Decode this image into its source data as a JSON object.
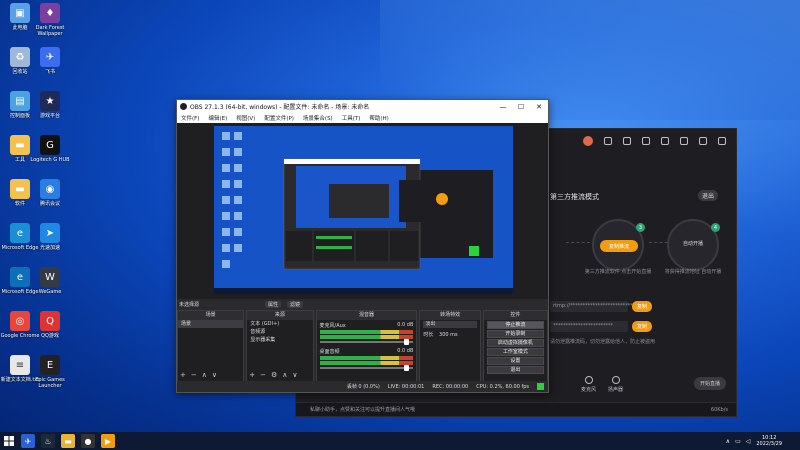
{
  "desktop": {
    "icons": [
      {
        "label": "此电脑",
        "icon": "computer-icon",
        "color": "#5aa0e6"
      },
      {
        "label": "Dark Forest Wallpaper",
        "icon": "game-icon",
        "color": "#7b3fa0"
      },
      {
        "label": "回收站",
        "icon": "recycle-bin-icon",
        "color": "#9fb8d8"
      },
      {
        "label": "飞书",
        "icon": "feishu-icon",
        "color": "#3c6df0"
      },
      {
        "label": "控制面板",
        "icon": "control-panel-icon",
        "color": "#4aa3df"
      },
      {
        "label": "游戏平台",
        "icon": "game-platform-icon",
        "color": "#1e2a5a"
      },
      {
        "label": "工具",
        "icon": "folder-icon",
        "color": "#f2c14e"
      },
      {
        "label": "Logitech G HUB",
        "icon": "logitech-icon",
        "color": "#111111"
      },
      {
        "label": "软件",
        "icon": "folder-icon",
        "color": "#f2c14e"
      },
      {
        "label": "腾讯会议",
        "icon": "meeting-icon",
        "color": "#2a7de1"
      },
      {
        "label": "Microsoft Edge",
        "icon": "edge-icon",
        "color": "#1a8fd4"
      },
      {
        "label": "光速加速",
        "icon": "accelerator-icon",
        "color": "#1e88e5"
      },
      {
        "label": "Microsoft Edge",
        "icon": "edge-icon",
        "color": "#0d6fb8"
      },
      {
        "label": "WeGame",
        "icon": "wegame-icon",
        "color": "#333a44"
      },
      {
        "label": "Google Chrome",
        "icon": "chrome-icon",
        "color": "#e8453c"
      },
      {
        "label": "QQ游戏",
        "icon": "qq-icon",
        "color": "#d33"
      },
      {
        "label": "新建文本文档.txt",
        "icon": "text-file-icon",
        "color": "#e8e8e8"
      },
      {
        "label": "Epic Games Launcher",
        "icon": "epic-icon",
        "color": "#222222"
      }
    ]
  },
  "bg_app": {
    "mode_text": "第三方推流模式",
    "exit_label": "退出",
    "step1_label": "复制推流",
    "step1_num": "3",
    "step1_text": "第三方推流软件 点击开始直播",
    "step2_label": "自动开播",
    "step2_num": "4",
    "step2_text": "将获得推流地址 自动开播",
    "field1": "rtmp://*************************",
    "field2": "************************",
    "copy_label": "复制",
    "hint": "请勿泄露推流码，切勿泄露给他人，防止被盗用",
    "controls": [
      "麦克风",
      "扬声器"
    ],
    "live_label": "开始直播",
    "footer": "私聊小助手，点赞和关注可以提升直播间人气哦",
    "speed": "60Kb/s"
  },
  "obs": {
    "title": "OBS 27.1.3 (64-bit, windows) - 配置文件: 未命名 - 场景: 未命名",
    "menu": [
      "文件(F)",
      "编辑(E)",
      "视图(V)",
      "配置文件(P)",
      "场景集合(S)",
      "工具(T)",
      "帮助(H)"
    ],
    "dock_left": "未选择源",
    "dock_props": "属性",
    "dock_filters": "滤镜",
    "scenes_title": "场景",
    "scenes": [
      "场景"
    ],
    "sources_title": "来源",
    "sources": [
      "文本 (GDI+)",
      "音频源",
      "显示器采集"
    ],
    "mixer_title": "混音器",
    "mixer": [
      {
        "name": "麦克风/Aux",
        "db": "0.0 dB"
      },
      {
        "name": "桌面音频",
        "db": "0.0 dB"
      }
    ],
    "transition_title": "转场特效",
    "transition_value": "淡出",
    "duration_label": "时长",
    "duration_value": "300 ms",
    "controls_title": "控件",
    "controls": [
      "停止推流",
      "开始录制",
      "启动虚拟摄像机",
      "工作室模式",
      "设置",
      "退出"
    ],
    "status": {
      "dropped": "丢帧 0 (0.0%)",
      "live": "LIVE: 00:00:01",
      "rec": "REC: 00:00:00",
      "cpu": "CPU: 0.2%, 60.00 fps"
    }
  },
  "taskbar": {
    "time": "10:12",
    "date": "2022/3/29"
  }
}
